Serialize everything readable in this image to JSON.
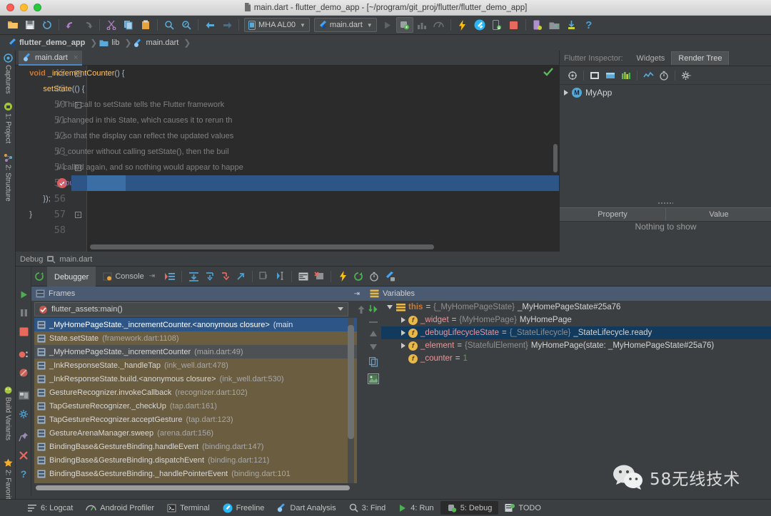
{
  "window": {
    "title": "main.dart - flutter_demo_app - [~/program/git_proj/flutter/flutter_demo_app]",
    "traffic": [
      "close-button",
      "minimize-button",
      "zoom-button"
    ]
  },
  "toolbar": {
    "device_combo": "MHA AL00",
    "run_config_combo": "main.dart",
    "icons": [
      "open-folder-icon",
      "save-all-icon",
      "sync-icon",
      "undo-icon",
      "redo-icon",
      "cut-icon",
      "copy-icon",
      "paste-icon",
      "find-icon",
      "replace-icon",
      "back-icon",
      "forward-icon",
      "run-icon",
      "debug-icon",
      "coverage-icon",
      "profile-icon",
      "hot-reload-icon",
      "flutter-icon",
      "install-icon",
      "stop-icon",
      "avd-manager-icon",
      "sdk-manager-icon",
      "attach-debugger-icon",
      "help-icon"
    ]
  },
  "breadcrumb": {
    "items": [
      {
        "label": "flutter_demo_app",
        "icon": "flutter-icon"
      },
      {
        "label": "lib",
        "icon": "folder-icon"
      },
      {
        "label": "main.dart",
        "icon": "dart-file-icon"
      }
    ]
  },
  "left_tool_tabs": [
    {
      "label": "Captures",
      "icon": "captures-icon"
    },
    {
      "label": "1: Project",
      "icon": "project-icon"
    },
    {
      "label": "2: Structure",
      "icon": "structure-icon"
    },
    {
      "label": "Build Variants",
      "icon": "build-variants-icon"
    },
    {
      "label": "2: Favorites",
      "icon": "favorites-star-icon"
    }
  ],
  "editor": {
    "tab_label": "main.dart",
    "tab_close": "×",
    "inspection_status": "ok-check-icon",
    "lines": [
      {
        "num": 48,
        "indent": 2,
        "fold": "open",
        "tokens": [
          {
            "t": "void ",
            "c": "kw"
          },
          {
            "t": "_incrementCounter",
            "c": "fn"
          },
          {
            "t": "() {",
            "c": "pn"
          }
        ]
      },
      {
        "num": 49,
        "indent": 4,
        "fold": "",
        "tokens": [
          {
            "t": "setState",
            "c": "fn"
          },
          {
            "t": "(() {",
            "c": "pn"
          }
        ]
      },
      {
        "num": 50,
        "indent": 6,
        "fold": "open",
        "tokens": [
          {
            "t": "// This call to setState tells the Flutter framework",
            "c": "cm"
          }
        ]
      },
      {
        "num": 51,
        "indent": 6,
        "fold": "",
        "tokens": [
          {
            "t": "// changed in this State, which causes it to rerun th",
            "c": "cm"
          }
        ]
      },
      {
        "num": 52,
        "indent": 6,
        "fold": "",
        "tokens": [
          {
            "t": "// so that the display can reflect the updated values",
            "c": "cm"
          }
        ]
      },
      {
        "num": 53,
        "indent": 6,
        "fold": "",
        "tokens": [
          {
            "t": "// _counter without calling setState(), then the buil",
            "c": "cm"
          }
        ]
      },
      {
        "num": 54,
        "indent": 6,
        "fold": "close",
        "tokens": [
          {
            "t": "// called again, and so nothing would appear to happe",
            "c": "cm"
          }
        ]
      },
      {
        "num": 55,
        "indent": 6,
        "fold": "",
        "highlight": true,
        "breakpoint": true,
        "tokens": [
          {
            "t": "_counter",
            "c": "fld"
          },
          {
            "t": "++;",
            "c": "pn"
          }
        ]
      },
      {
        "num": 56,
        "indent": 4,
        "fold": "",
        "tokens": [
          {
            "t": "});",
            "c": "pn"
          }
        ]
      },
      {
        "num": 57,
        "indent": 2,
        "fold": "close",
        "tokens": [
          {
            "t": "}",
            "c": "pn"
          }
        ]
      },
      {
        "num": 58,
        "indent": 0,
        "fold": "",
        "tokens": []
      }
    ]
  },
  "inspector": {
    "label": "Flutter Inspector:",
    "tabs": [
      {
        "label": "Widgets",
        "selected": false
      },
      {
        "label": "Render Tree",
        "selected": true
      }
    ],
    "toolbar_icons": [
      "select-widget-mode-icon",
      "debug-paint-icon",
      "paint-baselines-icon",
      "repaint-rainbow-icon",
      "performance-overlay-icon",
      "slow-animations-icon",
      "settings-gear-icon"
    ],
    "tree": [
      {
        "label": "MyApp",
        "badge": "M",
        "expandable": true
      }
    ],
    "property_table": {
      "columns": [
        "Property",
        "Value"
      ],
      "empty_message": "Nothing to show"
    }
  },
  "debug": {
    "header_label": "Debug",
    "header_target": "main.dart",
    "tabs": [
      {
        "label": "Debugger",
        "selected": true,
        "icon": ""
      },
      {
        "label": "Console",
        "selected": false,
        "icon": "console-icon"
      }
    ],
    "toolbar_icons": [
      "mute-breakpoints-icon",
      "show-execution-point-icon",
      "step-over-icon",
      "step-into-icon",
      "force-step-into-icon",
      "step-out-icon",
      "drop-frame-icon",
      "run-to-cursor-icon",
      "evaluate-expression-icon",
      "no-suspend-icon",
      "hot-reload-icon",
      "restart-icon",
      "timer-icon",
      "flutter-debug-icon"
    ],
    "rail_icons": [
      "resume-program-icon",
      "pause-program-icon",
      "stop-icon",
      "view-breakpoints-icon",
      "mute-breakpoints-icon",
      "restore-layout-icon",
      "settings-icon",
      "pin-tab-icon",
      "close-icon",
      "help-icon"
    ],
    "frames": {
      "title": "Frames",
      "thread_selector": "flutter_assets:main()",
      "items": [
        {
          "name": "_MyHomePageState._incrementCounter.<anonymous closure>",
          "loc": "(main",
          "state": "selected"
        },
        {
          "name": "State.setState",
          "loc": "(framework.dart:1108)",
          "state": ""
        },
        {
          "name": "_MyHomePageState._incrementCounter",
          "loc": "(main.dart:49)",
          "state": "current"
        },
        {
          "name": "_InkResponseState._handleTap",
          "loc": "(ink_well.dart:478)",
          "state": ""
        },
        {
          "name": "_InkResponseState.build.<anonymous closure>",
          "loc": "(ink_well.dart:530)",
          "state": ""
        },
        {
          "name": "GestureRecognizer.invokeCallback",
          "loc": "(recognizer.dart:102)",
          "state": ""
        },
        {
          "name": "TapGestureRecognizer._checkUp",
          "loc": "(tap.dart:161)",
          "state": ""
        },
        {
          "name": "TapGestureRecognizer.acceptGesture",
          "loc": "(tap.dart:123)",
          "state": ""
        },
        {
          "name": "GestureArenaManager.sweep",
          "loc": "(arena.dart:156)",
          "state": ""
        },
        {
          "name": "BindingBase&GestureBinding.handleEvent",
          "loc": "(binding.dart:147)",
          "state": ""
        },
        {
          "name": "BindingBase&GestureBinding.dispatchEvent",
          "loc": "(binding.dart:121)",
          "state": ""
        },
        {
          "name": "BindingBase&GestureBinding._handlePointerEvent",
          "loc": "(binding.dart:101",
          "state": ""
        }
      ]
    },
    "variables": {
      "title": "Variables",
      "rail_icons": [
        "evaluate-expression-icon",
        "collapse-icon",
        "up-icon",
        "down-icon",
        "copy-icon",
        "image-preview-icon"
      ],
      "items": [
        {
          "indent": 0,
          "arrow": "open",
          "icon": "stack-icon",
          "name": "this",
          "name_style": "this",
          "type": "{_MyHomePageState}",
          "value": "_MyHomePageState#25a76",
          "selected": false
        },
        {
          "indent": 1,
          "arrow": "closed",
          "icon": "field-icon",
          "name": "_widget",
          "type": "{MyHomePage}",
          "value": "MyHomePage",
          "selected": false
        },
        {
          "indent": 1,
          "arrow": "closed",
          "icon": "field-icon",
          "name": "_debugLifecycleState",
          "type": "{_StateLifecycle}",
          "value": "_StateLifecycle.ready",
          "selected": true
        },
        {
          "indent": 1,
          "arrow": "closed",
          "icon": "field-icon",
          "name": "_element",
          "type": "{StatefulElement}",
          "value": "MyHomePage(state: _MyHomePageState#25a76)",
          "selected": false
        },
        {
          "indent": 1,
          "arrow": "none",
          "icon": "field-icon",
          "name": "_counter",
          "type": "",
          "value": "1",
          "value_kind": "number",
          "selected": false
        }
      ]
    }
  },
  "watermark": {
    "text": "58无线技术",
    "icon": "wechat-icon"
  },
  "statusbar": {
    "items": [
      {
        "label": "6: Logcat",
        "key": "6",
        "icon": "logcat-icon",
        "selected": false
      },
      {
        "label": "Android Profiler",
        "key": "",
        "icon": "profiler-icon",
        "selected": false
      },
      {
        "label": "Terminal",
        "key": "",
        "icon": "terminal-icon",
        "selected": false
      },
      {
        "label": "Freeline",
        "key": "",
        "icon": "freeline-icon",
        "selected": false
      },
      {
        "label": "Dart Analysis",
        "key": "",
        "icon": "dart-icon",
        "selected": false
      },
      {
        "label": "3: Find",
        "key": "3",
        "icon": "find-icon",
        "selected": false
      },
      {
        "label": "4: Run",
        "key": "4",
        "icon": "run-icon",
        "selected": false
      },
      {
        "label": "5: Debug",
        "key": "5",
        "icon": "debug-icon",
        "selected": true
      },
      {
        "label": "TODO",
        "key": "",
        "icon": "todo-icon",
        "selected": false
      }
    ]
  },
  "colors": {
    "chrome": "#3c3f41",
    "editor_bg": "#2b2b2b",
    "selection": "#2d5586",
    "accent_blue": "#4a88c7",
    "frames_bg": "#6b5d3f",
    "pane_header": "#4a5a70"
  }
}
